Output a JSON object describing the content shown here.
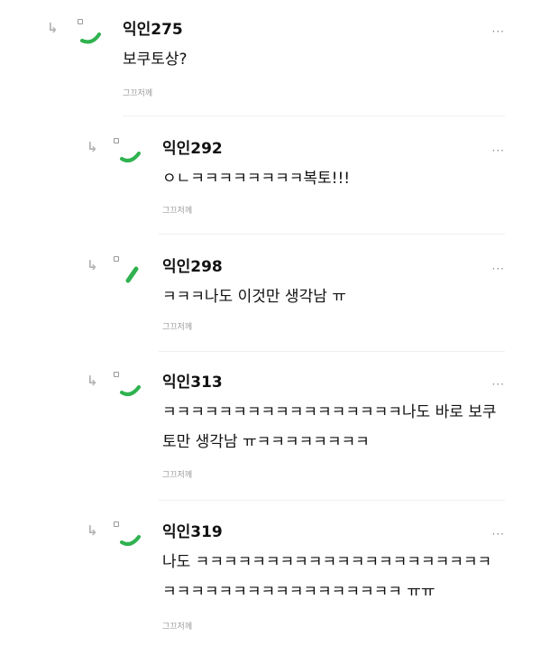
{
  "icons": {
    "reply": "reply-arrow-icon",
    "square": "small-square-icon",
    "avatar": "green-stroke-avatar-icon",
    "more": "more-dots-icon"
  },
  "colors": {
    "accent_green": "#2fb24f",
    "muted_text": "#9a9a9a",
    "divider": "#efefef"
  },
  "comments": [
    {
      "nickname": "익인275",
      "more": "···",
      "lines": [
        "보쿠토상?"
      ],
      "time": "그끄저께"
    },
    {
      "nickname": "익인292",
      "more": "···",
      "lines": [
        "ㅇㄴㅋㅋㅋㅋㅋㅋㅋㅋ복토!!!"
      ],
      "time": "그끄저께"
    },
    {
      "nickname": "익인298",
      "more": "···",
      "lines": [
        "ㅋㅋㅋ나도 이것만 생각남 ㅠ"
      ],
      "time": "그끄저께"
    },
    {
      "nickname": "익인313",
      "more": "···",
      "lines": [
        "ㅋㅋㅋㅋㅋㅋㅋㅋㅋㅋㅋㅋㅋㅋㅋㅋㅋ나도 바로 보쿠",
        "토만 생각남 ㅠㅋㅋㅋㅋㅋㅋㅋㅋ"
      ],
      "time": "그끄저께"
    },
    {
      "nickname": "익인319",
      "more": "···",
      "lines": [
        "나도 ㅋㅋㅋㅋㅋㅋㅋㅋㅋㅋㅋㅋㅋㅋㅋㅋㅋㅋㅋㅋㅋ",
        "ㅋㅋㅋㅋㅋㅋㅋㅋㅋㅋㅋㅋㅋㅋㅋㅋㅋ ㅠㅠ"
      ],
      "time": "그끄저께"
    }
  ]
}
